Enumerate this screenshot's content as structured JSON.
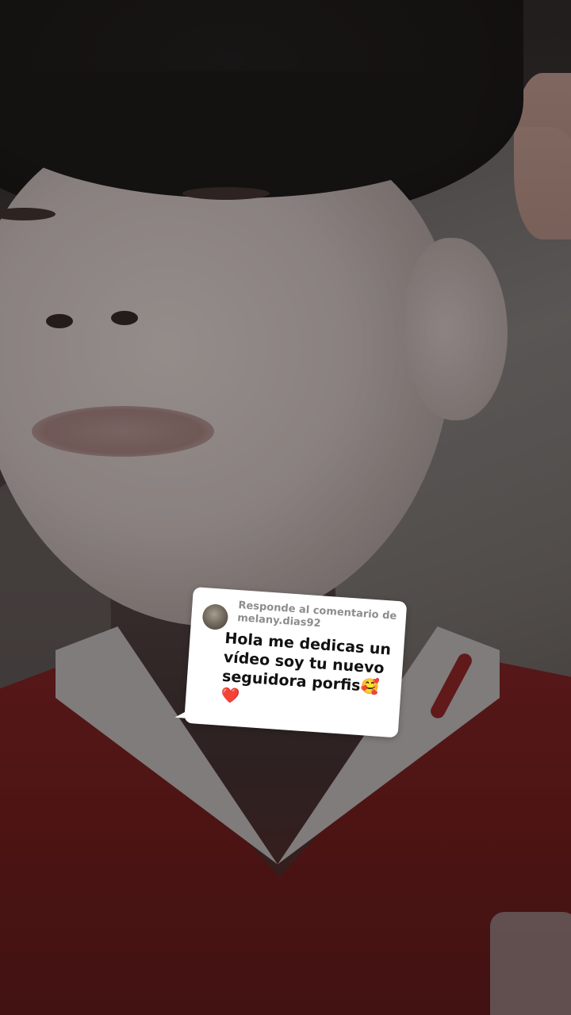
{
  "reply_sticker": {
    "label_line1": "Responde al comentario de",
    "username": "melany.dias92",
    "comment": "Hola me dedicas un vídeo soy tu nuevo seguidora porfis🥰❤️",
    "avatar_icon": "user-avatar-icon"
  },
  "colors": {
    "sticker_bg": "#ffffff",
    "label_gray": "#8d8d8d",
    "text_dark": "#111111",
    "shirt_red": "#7a1c1c"
  }
}
